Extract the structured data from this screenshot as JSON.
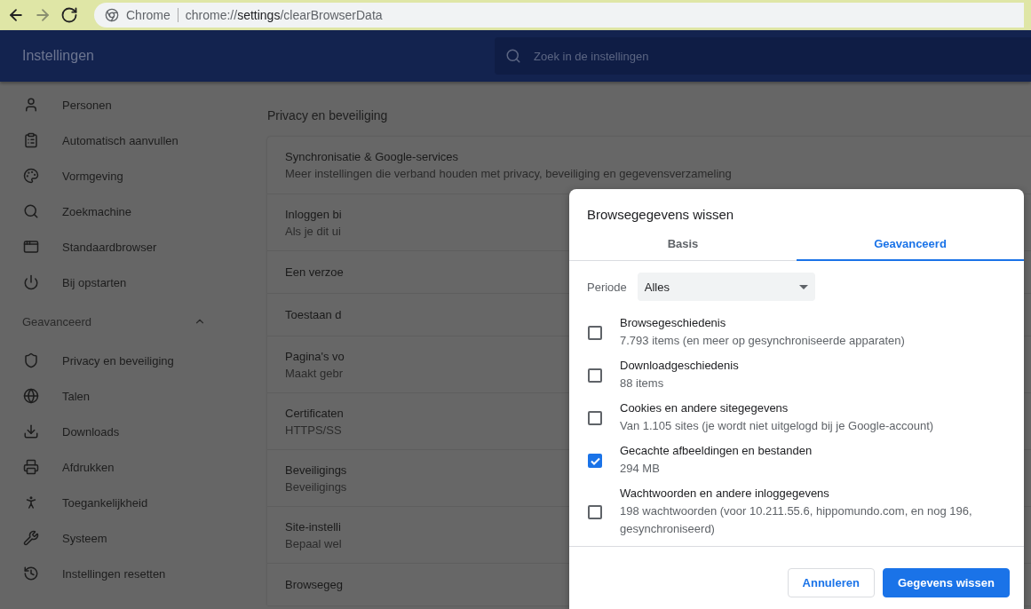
{
  "browser": {
    "nav": [
      {
        "kind": "back",
        "disabled": false
      },
      {
        "kind": "forward",
        "disabled": true
      },
      {
        "kind": "reload",
        "disabled": false
      }
    ],
    "origin": "Chrome",
    "url": "chrome://**settings**/clearBrowserData"
  },
  "header": {
    "title": "Instellingen",
    "search_placeholder": "Zoek in de instellingen"
  },
  "sidebar": {
    "items": [
      "Personen",
      "Automatisch aanvullen",
      "Vormgeving",
      "Zoekmachine",
      "Standaardbrowser",
      "Bij opstarten"
    ],
    "section": {
      "label": "Geavanceerd",
      "expanded": true,
      "items": [
        "Privacy en beveiliging",
        "Talen",
        "Downloads",
        "Afdrukken",
        "Toegankelijkheid",
        "Systeem",
        "Instellingen resetten"
      ]
    }
  },
  "content": {
    "heading": "Privacy en beveiliging",
    "rows": [
      {
        "title": "Synchronisatie & Google-services",
        "detail": "Meer instellingen die verband houden met privacy, beveiliging en gegevensverzameling"
      },
      {
        "title": "Inloggen bi",
        "detail": "Als je dit ui"
      },
      {
        "title": "Een verzoe"
      },
      {
        "title": "Toestaan d"
      },
      {
        "title": "Pagina's vo",
        "detail": "Maakt gebr"
      },
      {
        "title": "Certificaten",
        "detail": "HTTPS/SS"
      },
      {
        "title": "Beveiligings",
        "detail": "Beveiligings"
      },
      {
        "title": "Site-instelli",
        "detail": "Bepaal wel"
      },
      {
        "title": "Browsegeg"
      }
    ]
  },
  "dialog": {
    "title": "Browsegegevens wissen",
    "tabs": [
      {
        "label": "Basis",
        "selected": false
      },
      {
        "label": "Geavanceerd",
        "selected": true
      }
    ],
    "period": {
      "label": "Periode",
      "value": "Alles"
    },
    "options": [
      {
        "title": "Browsegeschiedenis",
        "detail": "7.793 items (en meer op gesynchroniseerde apparaten)",
        "checked": false
      },
      {
        "title": "Downloadgeschiedenis",
        "detail": "88 items",
        "checked": false
      },
      {
        "title": "Cookies en andere sitegegevens",
        "detail": "Van 1.105 sites (je wordt niet uitgelogd bij je Google-account)",
        "checked": false
      },
      {
        "title": "Gecachte afbeeldingen en bestanden",
        "detail": "294 MB",
        "checked": true
      },
      {
        "title": "Wachtwoorden en andere inloggegevens",
        "detail": "198 wachtwoorden (voor 10.211.55.6, hippomundo.com, en nog 196, gesynchroniseerd)",
        "checked": false
      }
    ],
    "buttons": [
      {
        "kind": "secondary",
        "label": "Annuleren"
      },
      {
        "kind": "primary",
        "label": "Gegevens wissen"
      }
    ]
  }
}
